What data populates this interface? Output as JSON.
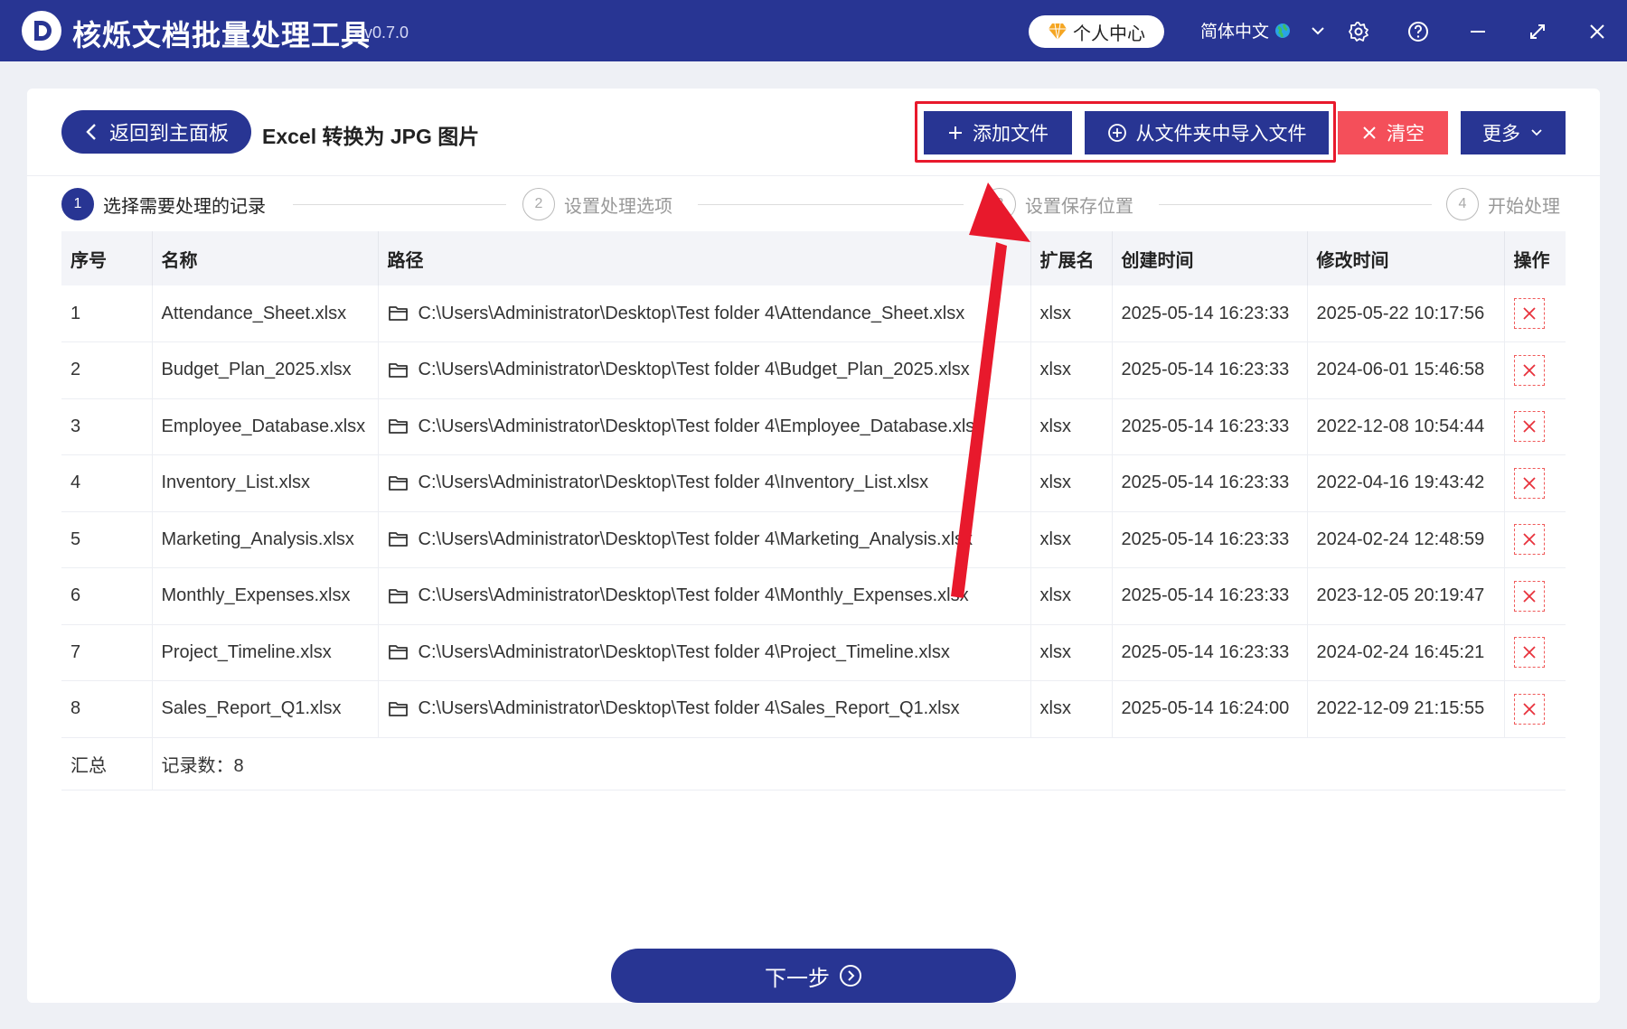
{
  "app": {
    "title": "核烁文档批量处理工具",
    "version": "- v0.7.0",
    "profile_label": "个人中心",
    "language": "简体中文"
  },
  "header": {
    "back_label": "返回到主面板",
    "page_title": "Excel 转换为 JPG 图片",
    "add_file_label": "添加文件",
    "import_folder_label": "从文件夹中导入文件",
    "clear_label": "清空",
    "more_label": "更多"
  },
  "steps": [
    {
      "num": "1",
      "label": "选择需要处理的记录"
    },
    {
      "num": "2",
      "label": "设置处理选项"
    },
    {
      "num": "3",
      "label": "设置保存位置"
    },
    {
      "num": "4",
      "label": "开始处理"
    }
  ],
  "table": {
    "headers": [
      "序号",
      "名称",
      "路径",
      "扩展名",
      "创建时间",
      "修改时间",
      "操作"
    ],
    "rows": [
      {
        "idx": "1",
        "name": "Attendance_Sheet.xlsx",
        "path": "C:\\Users\\Administrator\\Desktop\\Test folder 4\\Attendance_Sheet.xlsx",
        "ext": "xlsx",
        "created": "2025-05-14 16:23:33",
        "modified": "2025-05-22 10:17:56"
      },
      {
        "idx": "2",
        "name": "Budget_Plan_2025.xlsx",
        "path": "C:\\Users\\Administrator\\Desktop\\Test folder 4\\Budget_Plan_2025.xlsx",
        "ext": "xlsx",
        "created": "2025-05-14 16:23:33",
        "modified": "2024-06-01 15:46:58"
      },
      {
        "idx": "3",
        "name": "Employee_Database.xlsx",
        "path": "C:\\Users\\Administrator\\Desktop\\Test folder 4\\Employee_Database.xlsx",
        "ext": "xlsx",
        "created": "2025-05-14 16:23:33",
        "modified": "2022-12-08 10:54:44"
      },
      {
        "idx": "4",
        "name": "Inventory_List.xlsx",
        "path": "C:\\Users\\Administrator\\Desktop\\Test folder 4\\Inventory_List.xlsx",
        "ext": "xlsx",
        "created": "2025-05-14 16:23:33",
        "modified": "2022-04-16 19:43:42"
      },
      {
        "idx": "5",
        "name": "Marketing_Analysis.xlsx",
        "path": "C:\\Users\\Administrator\\Desktop\\Test folder 4\\Marketing_Analysis.xlsx",
        "ext": "xlsx",
        "created": "2025-05-14 16:23:33",
        "modified": "2024-02-24 12:48:59"
      },
      {
        "idx": "6",
        "name": "Monthly_Expenses.xlsx",
        "path": "C:\\Users\\Administrator\\Desktop\\Test folder 4\\Monthly_Expenses.xlsx",
        "ext": "xlsx",
        "created": "2025-05-14 16:23:33",
        "modified": "2023-12-05 20:19:47"
      },
      {
        "idx": "7",
        "name": "Project_Timeline.xlsx",
        "path": "C:\\Users\\Administrator\\Desktop\\Test folder 4\\Project_Timeline.xlsx",
        "ext": "xlsx",
        "created": "2025-05-14 16:23:33",
        "modified": "2024-02-24 16:45:21"
      },
      {
        "idx": "8",
        "name": "Sales_Report_Q1.xlsx",
        "path": "C:\\Users\\Administrator\\Desktop\\Test folder 4\\Sales_Report_Q1.xlsx",
        "ext": "xlsx",
        "created": "2025-05-14 16:24:00",
        "modified": "2022-12-09 21:15:55"
      }
    ],
    "summary_label": "汇总",
    "summary_count": "记录数：8"
  },
  "footer": {
    "next_label": "下一步"
  },
  "colors": {
    "primary": "#283593",
    "danger": "#f44f5a",
    "annotation": "#e8192c"
  }
}
